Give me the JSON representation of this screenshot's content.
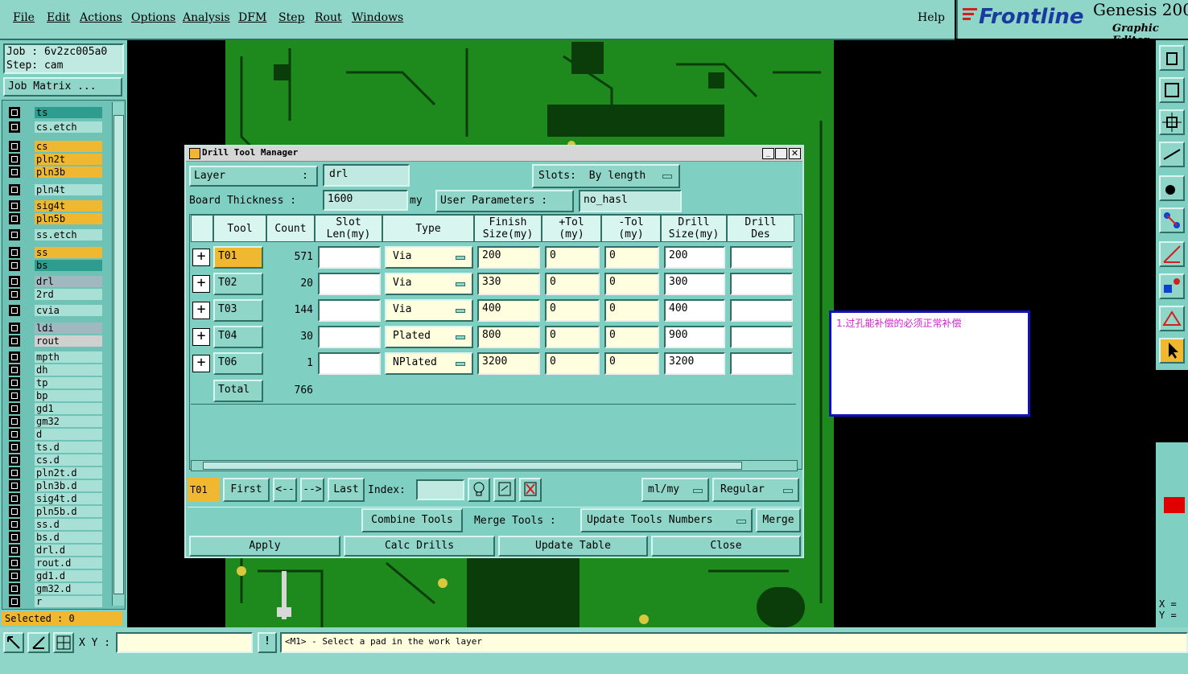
{
  "menu": [
    "File",
    "Edit",
    "Actions",
    "Options",
    "Analysis",
    "DFM",
    "Step",
    "Rout",
    "Windows"
  ],
  "help": "Help",
  "logo": {
    "brand": "Frontline",
    "product": "Genesis 200",
    "subtitle": "Graphic Editor"
  },
  "job": {
    "job_label": "Job : 6v2zc005a0",
    "step_label": "Step: cam",
    "matrix_button": "Job Matrix ..."
  },
  "layers": [
    {
      "name": "ts",
      "color": "#2e9d8f"
    },
    {
      "name": "cs.etch",
      "color": "#a8e0d6"
    },
    {
      "name": "cs",
      "color": "#f0b830"
    },
    {
      "name": "pln2t",
      "color": "#f0b830"
    },
    {
      "name": "pln3b",
      "color": "#f0b830"
    },
    {
      "name": "pln4t",
      "color": "#a8e0d6"
    },
    {
      "name": "sig4t",
      "color": "#f0b830"
    },
    {
      "name": "pln5b",
      "color": "#f0b830"
    },
    {
      "name": "ss.etch",
      "color": "#a8e0d6"
    },
    {
      "name": "ss",
      "color": "#f0b830"
    },
    {
      "name": "bs",
      "color": "#2e9d8f"
    },
    {
      "name": "drl",
      "color": "#a0b8c0"
    },
    {
      "name": "2rd",
      "color": "#a8e0d6"
    },
    {
      "name": "cvia",
      "color": "#a8e0d6"
    },
    {
      "name": "ldi",
      "color": "#a0b8c0"
    },
    {
      "name": "rout",
      "color": "#d0d0d0"
    },
    {
      "name": "mpth",
      "color": "#a8e0d6"
    },
    {
      "name": "dh",
      "color": "#a8e0d6"
    },
    {
      "name": "tp",
      "color": "#a8e0d6"
    },
    {
      "name": "bp",
      "color": "#a8e0d6"
    },
    {
      "name": "gd1",
      "color": "#a8e0d6"
    },
    {
      "name": "gm32",
      "color": "#a8e0d6"
    },
    {
      "name": "d",
      "color": "#a8e0d6"
    },
    {
      "name": "ts.d",
      "color": "#a8e0d6"
    },
    {
      "name": "cs.d",
      "color": "#a8e0d6"
    },
    {
      "name": "pln2t.d",
      "color": "#a8e0d6"
    },
    {
      "name": "pln3b.d",
      "color": "#a8e0d6"
    },
    {
      "name": "sig4t.d",
      "color": "#a8e0d6"
    },
    {
      "name": "pln5b.d",
      "color": "#a8e0d6"
    },
    {
      "name": "ss.d",
      "color": "#a8e0d6"
    },
    {
      "name": "bs.d",
      "color": "#a8e0d6"
    },
    {
      "name": "drl.d",
      "color": "#a8e0d6"
    },
    {
      "name": "rout.d",
      "color": "#a8e0d6"
    },
    {
      "name": "gd1.d",
      "color": "#a8e0d6"
    },
    {
      "name": "gm32.d",
      "color": "#a8e0d6"
    },
    {
      "name": "r",
      "color": "#a8e0d6"
    }
  ],
  "selected": "Selected : 0",
  "dialog": {
    "title": "Drill Tool Manager",
    "layer_label": "Layer",
    "layer_colon": ":",
    "layer_value": "drl",
    "slots_label": "Slots:",
    "slots_value": "By length",
    "board_thickness_label": "Board Thickness :",
    "board_thickness_value": "1600",
    "board_thickness_unit": "my",
    "user_params_label": "User Parameters :",
    "user_params_value": "no_hasl",
    "headers": [
      "Tool",
      "Count",
      "Slot\nLen(my)",
      "Type",
      "Finish\nSize(my)",
      "+Tol\n(my)",
      "-Tol\n(my)",
      "Drill\nSize(my)",
      "Drill\nDes"
    ],
    "rows": [
      {
        "tool": "T01",
        "count": "571",
        "slot": "",
        "type": "Via",
        "finish": "200",
        "ptol": "0",
        "mtol": "0",
        "drill": "200",
        "des": ""
      },
      {
        "tool": "T02",
        "count": "20",
        "slot": "",
        "type": "Via",
        "finish": "330",
        "ptol": "0",
        "mtol": "0",
        "drill": "300",
        "des": ""
      },
      {
        "tool": "T03",
        "count": "144",
        "slot": "",
        "type": "Via",
        "finish": "400",
        "ptol": "0",
        "mtol": "0",
        "drill": "400",
        "des": ""
      },
      {
        "tool": "T04",
        "count": "30",
        "slot": "",
        "type": "Plated",
        "finish": "800",
        "ptol": "0",
        "mtol": "0",
        "drill": "900",
        "des": ""
      },
      {
        "tool": "T06",
        "count": "1",
        "slot": "",
        "type": "NPlated",
        "finish": "3200",
        "ptol": "0",
        "mtol": "0",
        "drill": "3200",
        "des": ""
      }
    ],
    "total_label": "Total",
    "total_count": "766",
    "current_tool": "T01",
    "nav": {
      "first": "First",
      "prev": "<--",
      "next": "-->",
      "last": "Last",
      "index_label": "Index:"
    },
    "units_value": "ml/my",
    "mode_value": "Regular",
    "combine_tools": "Combine Tools",
    "merge_tools_label": "Merge Tools :",
    "update_tools_numbers": "Update Tools Numbers",
    "merge": "Merge",
    "apply": "Apply",
    "calc_drills": "Calc Drills",
    "update_table": "Update Table",
    "close": "Close"
  },
  "note_text": "1.过孔能补偿的必须正常补偿",
  "status": {
    "xy_label": "X Y :",
    "message": "<M1> - Select a pad in the work layer",
    "x_label": "X =",
    "y_label": "Y ="
  }
}
